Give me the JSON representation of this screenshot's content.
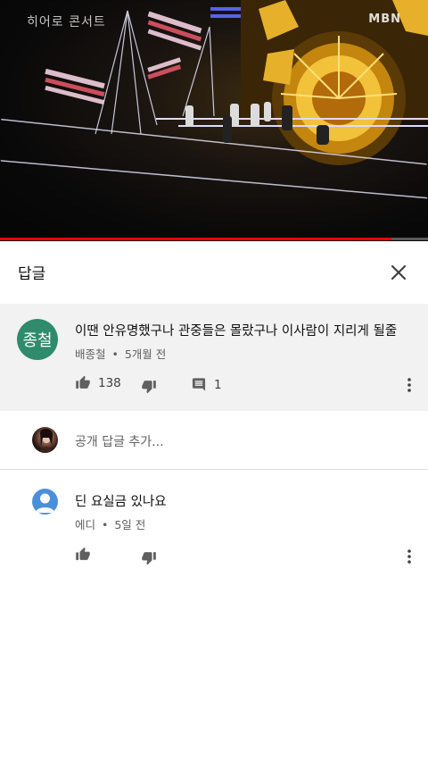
{
  "video": {
    "watermark_left": "히어로 콘서트",
    "watermark_right": "MBN",
    "progress": 0.915,
    "progress_color": "#ff0000"
  },
  "header": {
    "title": "답글",
    "close_icon": "close-icon"
  },
  "parent_comment": {
    "avatar_text": "종철",
    "avatar_color": "#2e8b6b",
    "text": "이땐 안유명했구나 관중들은 몰랐구나 이사람이 지리게 될줄",
    "author": "배종철",
    "time": "5개월 전",
    "likes": "138",
    "replies": "1"
  },
  "add_reply": {
    "placeholder": "공개 답글 추가..."
  },
  "reply": {
    "text": "딘 요실금 있나요",
    "author": "에디",
    "time": "5일 전",
    "avatar_color": "#4a8fdc"
  },
  "separator": "•"
}
